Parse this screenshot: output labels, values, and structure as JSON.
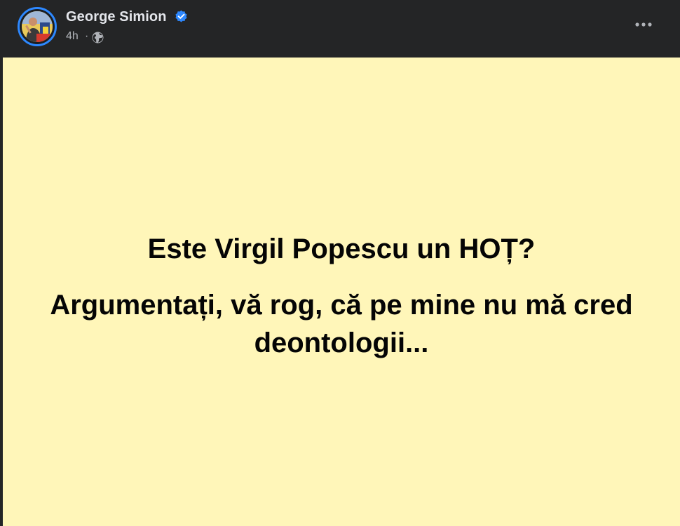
{
  "author": {
    "name": "George Simion",
    "verified": true
  },
  "meta": {
    "timestamp": "4h",
    "separator": "·",
    "audience_icon": "globe-icon"
  },
  "actions": {
    "more_icon": "more-options-icon"
  },
  "post": {
    "background_color": "#fff6b9",
    "line_1": "Este Virgil Popescu un HOȚ?",
    "line_2": "Argumentați, vă rog, că pe mine nu mă cred deontologii..."
  }
}
